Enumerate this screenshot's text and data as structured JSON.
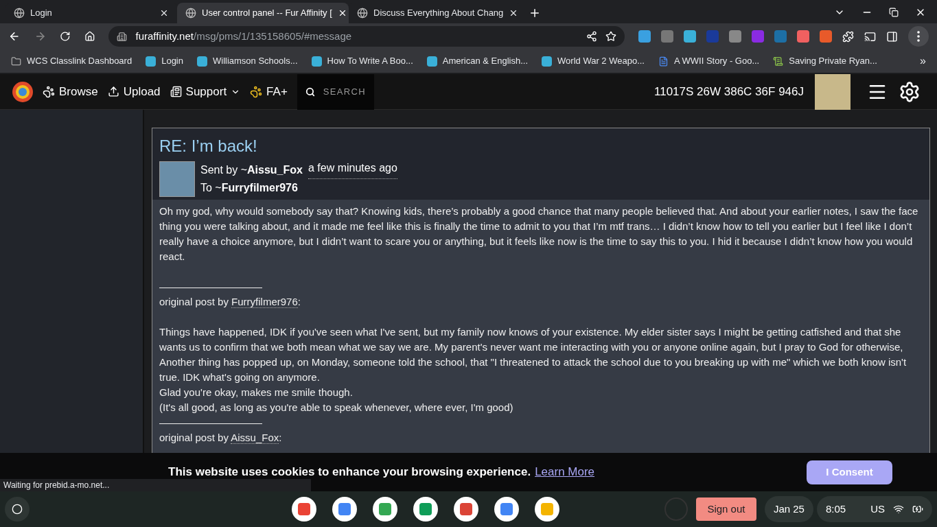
{
  "browser": {
    "tabs": [
      {
        "title": "Login",
        "selected": false
      },
      {
        "title": "User control panel -- Fur Affinity [",
        "selected": true
      },
      {
        "title": "Discuss Everything About Chang",
        "selected": false
      }
    ],
    "address": {
      "domain": "furaffinity.net",
      "path": "/msg/pms/1/135158605/#message"
    },
    "bookmarks": [
      "WCS Classlink Dashboard",
      "Login",
      "Williamson Schools...",
      "How To Write A Boo...",
      "American & English...",
      "World War 2 Weapo...",
      "A WWII Story - Goo...",
      "Saving Private Ryan..."
    ],
    "more": "»"
  },
  "site_nav": {
    "items": [
      "Browse",
      "Upload",
      "Support",
      "FA+"
    ],
    "search_placeholder": "SEARCH",
    "stats": "11017S 26W 386C 36F 946J"
  },
  "message": {
    "title": "RE: I’m back!",
    "sent_by": "Sent by ~",
    "sender": "Aissu_Fox",
    "time": "a few minutes ago",
    "to": "To ~",
    "recipient": "Furryfilmer976",
    "body": [
      {
        "kind": "text",
        "text": "Oh my god, why would somebody say that? Knowing kids, there’s probably a good chance that many people believed that. And about your earlier notes, I saw the face thing you were talking about, and it made me feel like this is finally the time to admit to you that I’m mtf trans… I didn’t know how to tell you earlier but I feel like I don’t really have a choice anymore, but I didn’t want to scare you or anything, but it feels like now is the time to say this to you. I hid it because I didn’t know how you would react."
      },
      {
        "kind": "gap"
      },
      {
        "kind": "text",
        "text": "——————————"
      },
      {
        "kind": "quote",
        "prefix": "original post by ",
        "user": "Furryfilmer976",
        "suffix": ":"
      },
      {
        "kind": "gap"
      },
      {
        "kind": "text",
        "text": "Things have happened, IDK if you've seen what I've sent, but my family now knows of your existence. My elder sister says I might be getting catfished and that she wants us to confirm that we both mean what we say we are. My parent's never want me interacting with you or anyone online again, but I pray to God for otherwise, Another thing has popped up, on Monday, someone told the school, that \"I threatened to attack the school due to you breaking up with me\" which we both know isn't true. IDK what's going on anymore."
      },
      {
        "kind": "text",
        "text": "Glad you're okay, makes me smile though."
      },
      {
        "kind": "text",
        "text": "(It's all good, as long as you're able to speak whenever, where ever, I'm good)"
      },
      {
        "kind": "text",
        "text": "——————————"
      },
      {
        "kind": "quote",
        "prefix": "original post by ",
        "user": "Aissu_Fox",
        "suffix": ":"
      }
    ]
  },
  "cookie_banner": {
    "text": "This website uses cookies to enhance your browsing experience.",
    "link": "Learn More",
    "button": "I Consent"
  },
  "status": "Waiting for prebid.a-mo.net...",
  "shelf": {
    "sign_out": "Sign out",
    "date": "Jan 25",
    "time": "8:05",
    "locale": "US"
  }
}
